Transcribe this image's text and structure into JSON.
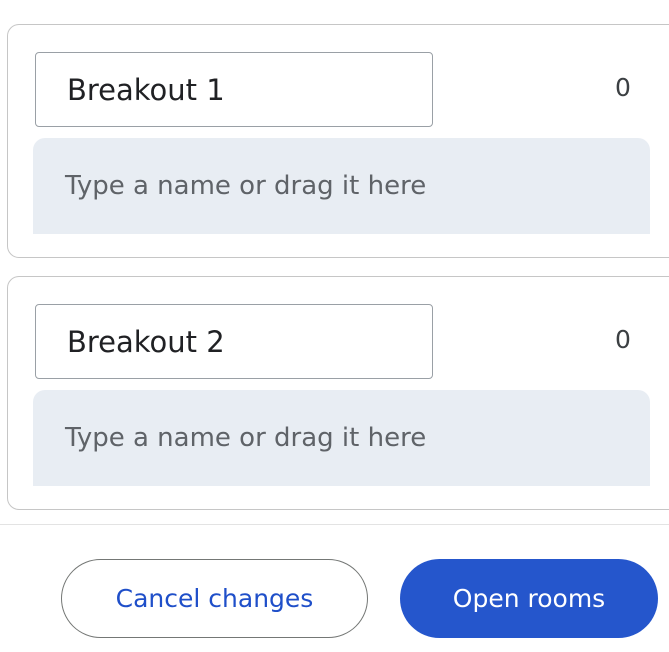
{
  "rooms": [
    {
      "name": "Breakout 1",
      "count": "0",
      "drop_placeholder": "Type a name or drag it here"
    },
    {
      "name": "Breakout 2",
      "count": "0",
      "drop_placeholder": "Type a name or drag it here"
    }
  ],
  "actions": {
    "cancel_label": "Cancel changes",
    "open_label": "Open rooms"
  },
  "colors": {
    "primary": "#2556cc",
    "primary_text": "#1f4fc9",
    "drop_zone_bg": "#e8edf3"
  }
}
